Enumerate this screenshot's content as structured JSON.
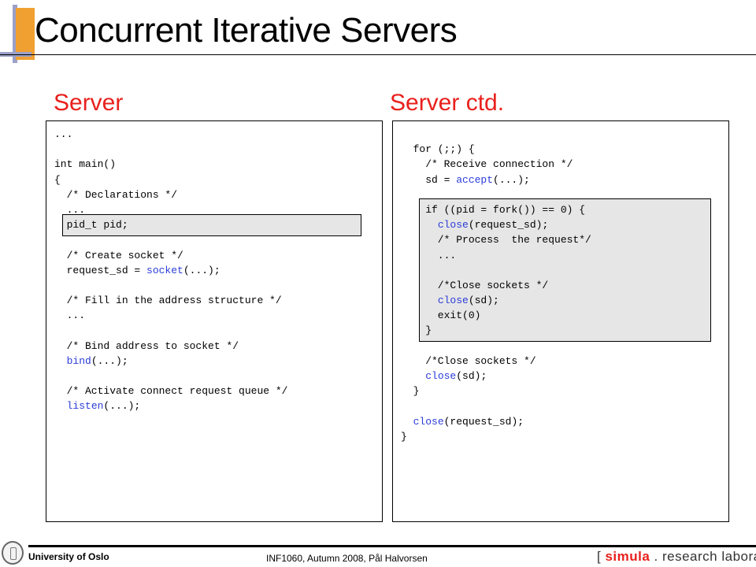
{
  "slide": {
    "title": "Concurrent Iterative Servers",
    "left_heading": "Server",
    "right_heading": "Server ctd."
  },
  "left_code": {
    "lines": [
      "...",
      "",
      "int main()",
      "{",
      "  /* Declarations */",
      "  ...",
      "  pid_t pid;",
      "",
      "  /* Create socket */",
      "  request_sd = socket(...);",
      "",
      "  /* Fill in the address structure */",
      "  ...",
      "",
      "  /* Bind address to socket */",
      "  bind(...);",
      "",
      "  /* Activate connect request queue */",
      "  listen(...);"
    ]
  },
  "right_code": {
    "lines": [
      "",
      "  for (;;) {",
      "    /* Receive connection */",
      "    sd = accept(...);",
      "",
      "    if ((pid = fork()) == 0) {",
      "      close(request_sd);",
      "      /* Process  the request*/",
      "      ...",
      "",
      "      /*Close sockets */",
      "      close(sd);",
      "      exit(0)",
      "    }",
      "",
      "    /*Close sockets */",
      "    close(sd);",
      "  }",
      "",
      "  close(request_sd);",
      "}"
    ]
  },
  "highlight_functions": [
    "socket",
    "bind",
    "listen",
    "accept",
    "close"
  ],
  "colors": {
    "heading": "#e8201c",
    "function": "#2a3bd8",
    "highlight_box": "#e6e6e6",
    "accent_orange": "#f0a030",
    "accent_blue": "#9aa0c8"
  },
  "footer": {
    "university": "University of Oslo",
    "course": "INF1060,  Autumn 2008,  Pål Halvorsen",
    "lab_open": "[ ",
    "lab_brand": "simula",
    "lab_rest": " . research laboratory ]"
  }
}
